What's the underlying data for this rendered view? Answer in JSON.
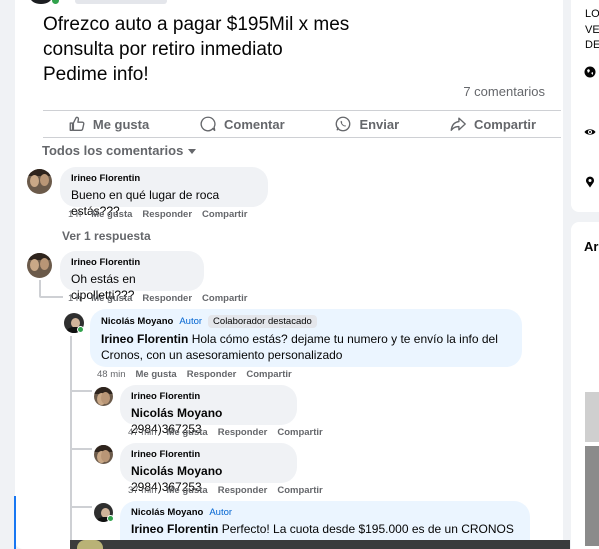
{
  "post": {
    "lines": [
      "Ofrezco auto a pagar $195Mil x mes",
      "consulta por retiro inmediato",
      "Pedime info!"
    ],
    "comments_count": "7 comentarios"
  },
  "actions": {
    "like": "Me gusta",
    "comment": "Comentar",
    "send": "Enviar",
    "share": "Compartir"
  },
  "filter": {
    "label": "Todos los comentarios"
  },
  "meta_labels": {
    "like": "Me gusta",
    "reply": "Responder",
    "share": "Compartir"
  },
  "comments": [
    {
      "author": "Irineo Florentin",
      "text": "Bueno en qué lugar de roca estás???",
      "time": "1 h"
    },
    {
      "author": "Irineo Florentin",
      "text": "Oh estás en cipolletti???",
      "time": "1 h"
    }
  ],
  "view_replies": "Ver 1 respuesta",
  "replies": [
    {
      "author": "Nicolás Moyano",
      "badge_author": "Autor",
      "badge_role": "Colaborador destacado",
      "mention": "Irineo Florentin",
      "text": "Hola cómo estás? dejame tu numero y te envío la info del Cronos, con un asesoramiento personalizado",
      "time": "48 min"
    },
    {
      "author": "Irineo Florentin",
      "mention": "Nicolás Moyano",
      "text": "2984)367253",
      "time": "47 min"
    },
    {
      "author": "Irineo Florentin",
      "mention": "Nicolás Moyano",
      "text": "2984)367253",
      "time": "37 min"
    },
    {
      "author": "Nicolás Moyano",
      "badge_author": "Autor",
      "mention": "Irineo Florentin",
      "text": "Perfecto! La cuota desde $195.000 es de un CRONOS"
    }
  ],
  "right_panel": {
    "line1": "LO",
    "line2": "VE",
    "line3": "DE",
    "heading": "Ar"
  }
}
